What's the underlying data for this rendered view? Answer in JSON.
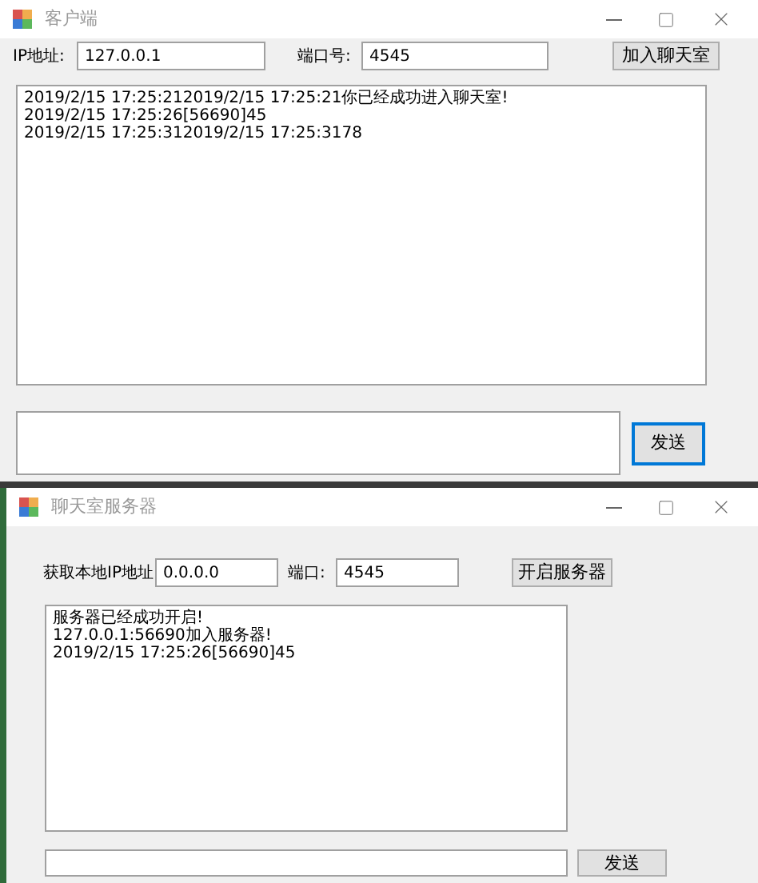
{
  "client": {
    "title": "客户端",
    "ip_label": "IP地址:",
    "ip_value": "127.0.0.1",
    "port_label": "端口号:",
    "port_value": "4545",
    "join_button": "加入聊天室",
    "log_lines": [
      "2019/2/15 17:25:212019/2/15 17:25:21你已经成功进入聊天室!",
      "2019/2/15 17:25:26[56690]45",
      "2019/2/15 17:25:312019/2/15 17:25:3178"
    ],
    "send_button": {
      "label": "发送",
      "focused": true
    }
  },
  "server": {
    "title": "聊天室服务器",
    "ip_label": "获取本地IP地址",
    "ip_value": "0.0.0.0",
    "port_label": "端口:",
    "port_value": "4545",
    "start_button": "开启服务器",
    "log_lines": [
      "服务器已经成功开启!",
      "127.0.0.1:56690加入服务器!",
      "2019/2/15 17:25:26[56690]45"
    ],
    "send_button": {
      "label": "发送",
      "focused": false
    }
  }
}
